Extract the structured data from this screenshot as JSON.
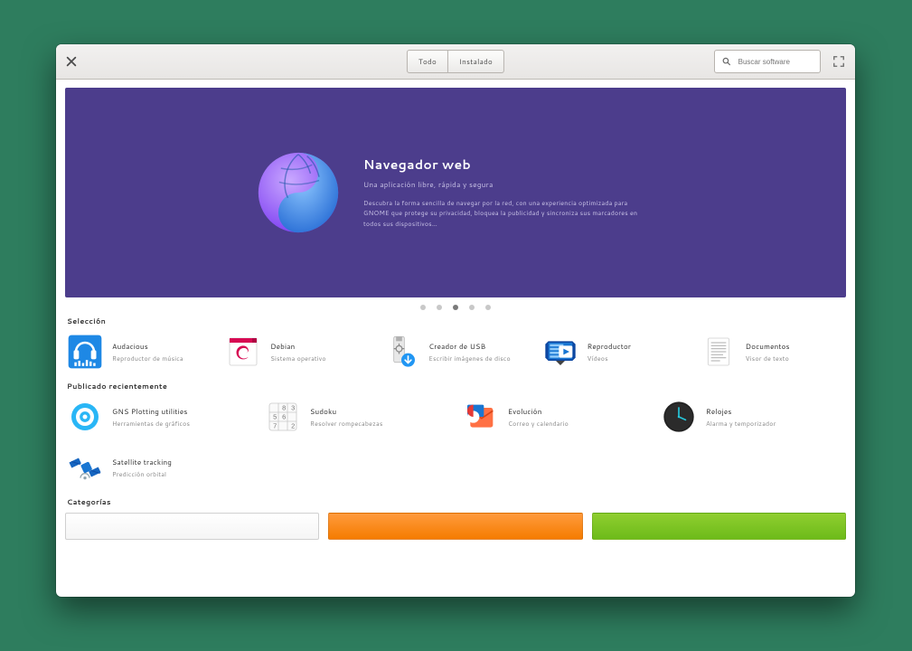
{
  "header": {
    "tabs": [
      "Todo",
      "Instalado"
    ],
    "search_placeholder": "Buscar software"
  },
  "hero": {
    "title": "Navegador web",
    "subtitle": "Una aplicación libre, rápida y segura",
    "description": "Descubra la forma sencilla de navegar por la red, con una experiencia optimizada para GNOME que protege su privacidad, bloquea la publicidad y sincroniza sus marcadores en todos sus dispositivos…"
  },
  "pager": {
    "count": 5,
    "active": 2
  },
  "sections": {
    "choice": {
      "title": "Selección",
      "apps": [
        {
          "name": "Audacious",
          "desc": "Reproductor de música",
          "icon": "headphones"
        },
        {
          "name": "Debian",
          "desc": "Sistema operativo",
          "icon": "debian"
        },
        {
          "name": "Creador de USB",
          "desc": "Escribir imágenes de disco",
          "icon": "usb"
        },
        {
          "name": "Reproductor",
          "desc": "Vídeos",
          "icon": "player"
        },
        {
          "name": "Documentos",
          "desc": "Visor de texto",
          "icon": "document"
        }
      ]
    },
    "recent": {
      "title": "Publicado recientemente",
      "apps": [
        {
          "name": "GNS Plotting utilities",
          "desc": "Herramientas de gráficos",
          "icon": "target"
        },
        {
          "name": "Sudoku",
          "desc": "Resolver rompecabezas",
          "icon": "sudoku"
        },
        {
          "name": "Evolución",
          "desc": "Correo y calendario",
          "icon": "mail"
        },
        {
          "name": "Relojes",
          "desc": "Alarma y temporizador",
          "icon": "clock"
        }
      ],
      "extra": [
        {
          "name": "Satellite tracking",
          "desc": "Predicción orbital",
          "icon": "satellite"
        }
      ]
    },
    "categories": {
      "title": "Categorías"
    }
  }
}
